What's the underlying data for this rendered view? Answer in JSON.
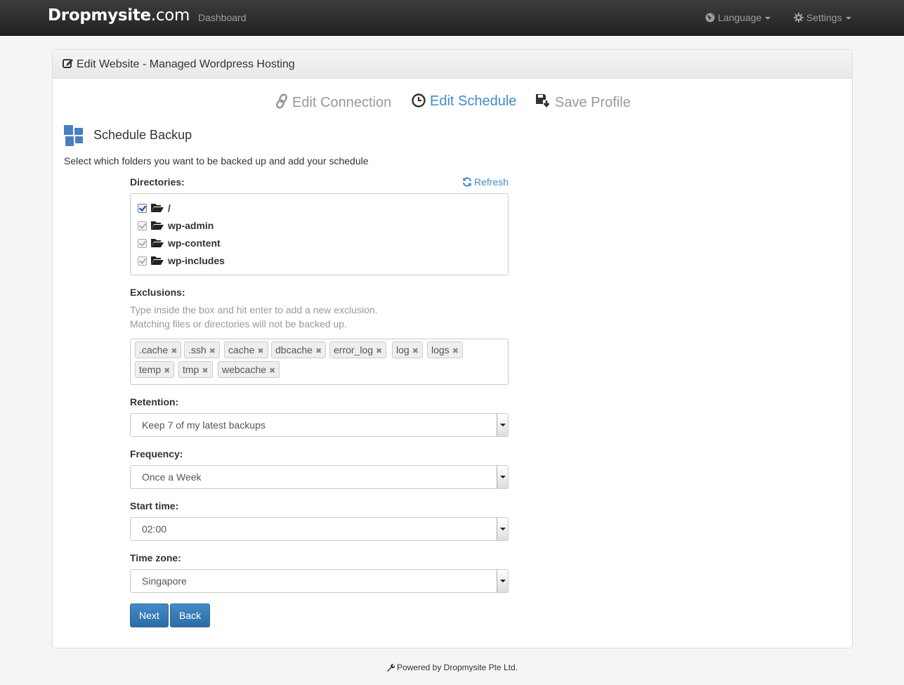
{
  "navbar": {
    "brand_bold": "Dropmysite",
    "brand_rest": ".com",
    "dashboard": "Dashboard",
    "language": "Language",
    "settings": "Settings"
  },
  "panel": {
    "heading": "Edit Website - Managed Wordpress Hosting"
  },
  "steps": {
    "connection": "Edit Connection",
    "schedule": "Edit Schedule",
    "save": "Save Profile"
  },
  "section": {
    "title": "Schedule Backup",
    "intro": "Select which folders you want to be backed up and add your schedule"
  },
  "directories": {
    "label": "Directories:",
    "refresh": "Refresh",
    "items": [
      {
        "name": "/",
        "checked": true
      },
      {
        "name": "wp-admin",
        "checked": true
      },
      {
        "name": "wp-content",
        "checked": true
      },
      {
        "name": "wp-includes",
        "checked": true
      }
    ]
  },
  "exclusions": {
    "label": "Exclusions:",
    "help1": "Type inside the box and hit enter to add a new exclusion.",
    "help2": "Matching files or directories will not be backed up.",
    "tags": [
      ".cache",
      ".ssh",
      "cache",
      "dbcache",
      "error_log",
      "log",
      "logs",
      "temp",
      "tmp",
      "webcache"
    ]
  },
  "retention": {
    "label": "Retention:",
    "value": "Keep 7 of my latest backups"
  },
  "frequency": {
    "label": "Frequency:",
    "value": "Once a Week"
  },
  "start_time": {
    "label": "Start time:",
    "value": "02:00"
  },
  "timezone": {
    "label": "Time zone:",
    "value": "Singapore"
  },
  "buttons": {
    "next": "Next",
    "back": "Back"
  },
  "footer": {
    "text": "Powered by Dropmysite Pte Ltd."
  },
  "colors": {
    "accent": "#428bca",
    "navbar": "#222222",
    "muted": "#999999"
  }
}
